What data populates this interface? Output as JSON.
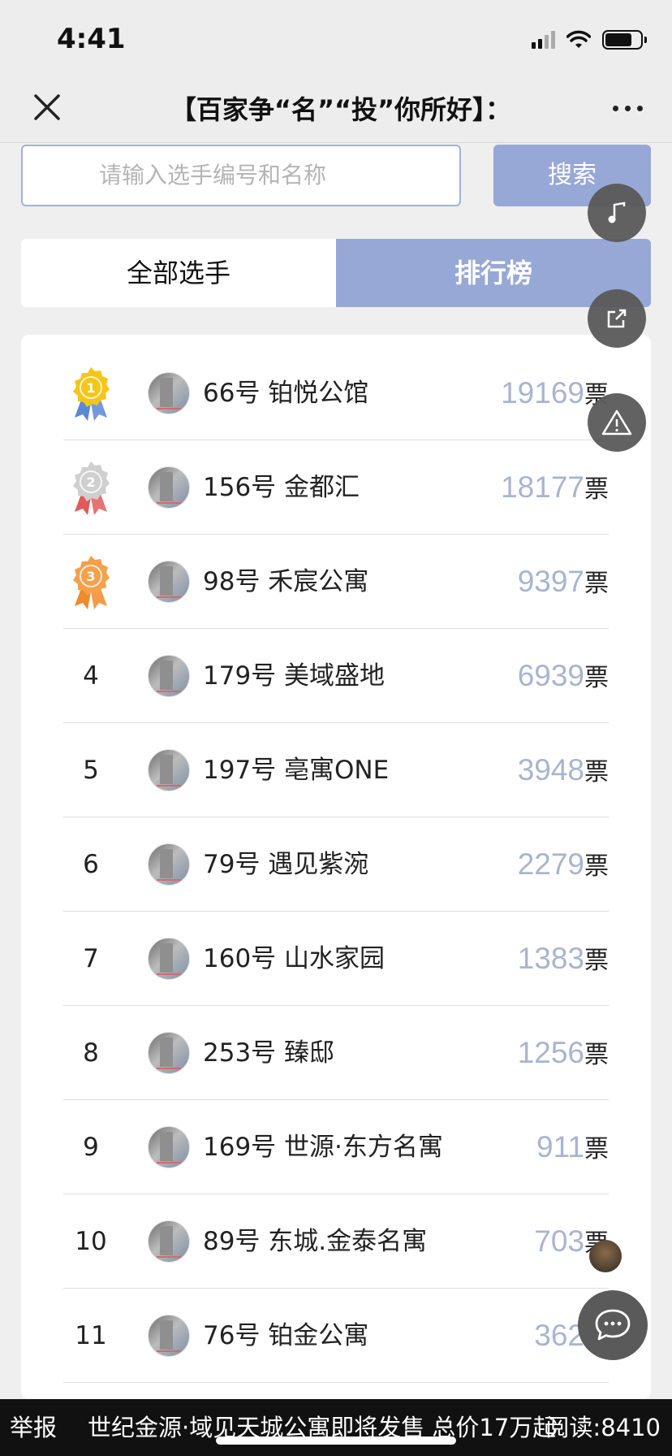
{
  "status_bar": {
    "time": "4:41"
  },
  "title_bar": {
    "title": "【百家争“名”“投”你所好】："
  },
  "search": {
    "placeholder": "请输入选手编号和名称",
    "button_label": "搜索"
  },
  "tabs": [
    {
      "label": "全部选手",
      "active": false
    },
    {
      "label": "排行榜",
      "active": true
    }
  ],
  "ranking": {
    "vote_unit": "票",
    "items": [
      {
        "rank": "1",
        "medal": "gold",
        "name": "66号  铂悦公馆",
        "votes": "19169"
      },
      {
        "rank": "2",
        "medal": "silver",
        "name": "156号  金都汇",
        "votes": "18177"
      },
      {
        "rank": "3",
        "medal": "bronze",
        "name": "98号  禾宸公寓",
        "votes": "9397"
      },
      {
        "rank": "4",
        "medal": null,
        "name": "179号  美域盛地",
        "votes": "6939"
      },
      {
        "rank": "5",
        "medal": null,
        "name": "197号  亳寓ONE",
        "votes": "3948"
      },
      {
        "rank": "6",
        "medal": null,
        "name": "79号  遇见紫涴",
        "votes": "2279"
      },
      {
        "rank": "7",
        "medal": null,
        "name": "160号  山水家园",
        "votes": "1383"
      },
      {
        "rank": "8",
        "medal": null,
        "name": "253号  臻邸",
        "votes": "1256"
      },
      {
        "rank": "9",
        "medal": null,
        "name": "169号  世源·东方名寓",
        "votes": "911"
      },
      {
        "rank": "10",
        "medal": null,
        "name": "89号  东城.金泰名寓",
        "votes": "703"
      },
      {
        "rank": "11",
        "medal": null,
        "name": "76号  铂金公寓",
        "votes": "362"
      }
    ]
  },
  "floating_buttons": [
    "music-icon",
    "share-icon",
    "warning-icon",
    "chat-icon"
  ],
  "bottom_bar": {
    "report_label": "举报",
    "ticker_text": "世纪金源·域见天城公寓即将发售 总价17万起",
    "reads_label": "阅读:8410"
  },
  "colors": {
    "accent": "#97a8d6",
    "vote_number": "#a9b4cf",
    "gold": "#f5c518",
    "silver": "#cfcfcf",
    "bronze": "#f5a04a"
  }
}
